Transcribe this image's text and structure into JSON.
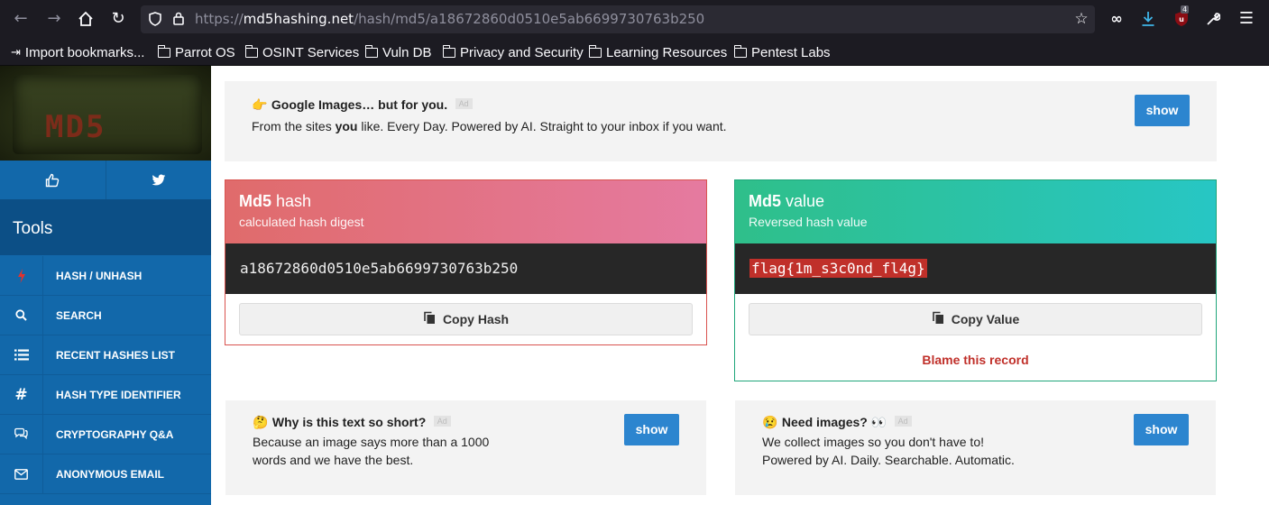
{
  "browser": {
    "url_scheme": "https://",
    "url_host": "md5hashing.net",
    "url_path": "/hash/md5/a18672860d0510e5ab6699730763b250",
    "extension_badge": "4",
    "bookmarks": [
      {
        "label": "Import bookmarks...",
        "icon": "import-icon"
      },
      {
        "label": "Parrot OS",
        "icon": "folder-icon"
      },
      {
        "label": "OSINT Services",
        "icon": "folder-icon"
      },
      {
        "label": "Vuln DB",
        "icon": "folder-icon"
      },
      {
        "label": "Privacy and Security",
        "icon": "folder-icon"
      },
      {
        "label": "Learning Resources",
        "icon": "folder-icon"
      },
      {
        "label": "Pentest Labs",
        "icon": "folder-icon"
      }
    ]
  },
  "sidebar": {
    "logo_text": "MD5",
    "tools_heading": "Tools",
    "items": [
      {
        "label": "HASH / UNHASH",
        "icon": "lightning-icon"
      },
      {
        "label": "SEARCH",
        "icon": "search-icon"
      },
      {
        "label": "RECENT HASHES LIST",
        "icon": "list-icon"
      },
      {
        "label": "HASH TYPE IDENTIFIER",
        "icon": "hashtag-icon"
      },
      {
        "label": "CRYPTOGRAPHY Q&A",
        "icon": "chat-icon"
      },
      {
        "label": "ANONYMOUS EMAIL",
        "icon": "envelope-icon"
      }
    ]
  },
  "ads": {
    "top": {
      "emoji": "👉",
      "title": "Google Images… but for you.",
      "tag": "Ad",
      "body_before": "From the sites ",
      "body_bold": "you",
      "body_after": " like. Every Day. Powered by AI. Straight to your inbox if you want.",
      "button": "show"
    },
    "left": {
      "emoji": "🤔",
      "title": "Why is this text so short?",
      "tag": "Ad",
      "line1": "Because an image says more than a 1000",
      "line2": "words and we have the best.",
      "button": "show"
    },
    "right": {
      "emoji": "😢",
      "title": "Need images? 👀",
      "tag": "Ad",
      "line1": "We collect images so you don't have to!",
      "line2": "Powered by AI. Daily. Searchable. Automatic.",
      "button": "show"
    }
  },
  "hash_card": {
    "title_bold": "Md5",
    "title_rest": " hash",
    "subtitle": "calculated hash digest",
    "value": "a18672860d0510e5ab6699730763b250",
    "button": "Copy Hash",
    "head_color_start": "#e06b6b",
    "head_color_end": "#e57aa0"
  },
  "value_card": {
    "title_bold": "Md5",
    "title_rest": " value",
    "subtitle": "Reversed hash value",
    "value": "flag{1m_s3c0nd_fl4g}",
    "button": "Copy Value",
    "blame": "Blame this record",
    "head_color_start": "#2fbf8a",
    "head_color_end": "#27c6c4"
  }
}
